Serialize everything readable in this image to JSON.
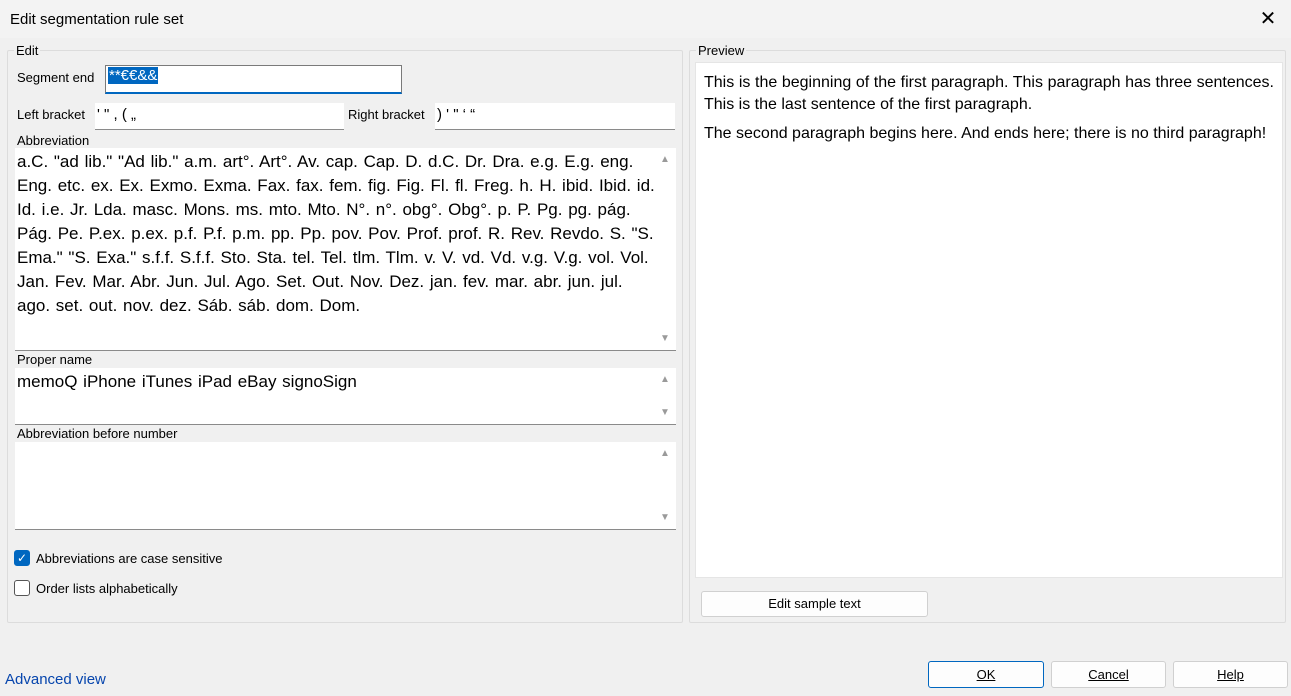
{
  "window": {
    "title": "Edit segmentation rule set",
    "close_icon": "close-icon"
  },
  "edit_group": {
    "label": "Edit",
    "segment_end_label": "Segment end",
    "segment_end_value": "**€€&&",
    "left_bracket_label": "Left bracket",
    "left_bracket_value": "' \" , ( „",
    "right_bracket_label": "Right bracket",
    "right_bracket_value": ") ' \" ‘ “",
    "abbreviation_label": "Abbreviation",
    "abbreviation_value": "a.C. \"ad lib.\" \"Ad lib.\" a.m. art°. Art°. Av. cap. Cap. D. d.C. Dr. Dra. e.g. E.g. eng. Eng. etc. ex. Ex. Exmo. Exma. Fax. fax. fem. fig. Fig. Fl. fl. Freg. h. H. ibid. Ibid. id. Id. i.e. Jr. Lda. masc. Mons. ms. mto. Mto. N°. n°. obg°. Obg°. p. P. Pg. pg. pág. Pág. Pe. P.ex. p.ex. p.f. P.f. p.m. pp. Pp. pov. Pov. Prof. prof. R. Rev. Revdo. S. \"S. Ema.\" \"S. Exa.\" s.f.f. S.f.f. Sto. Sta. tel. Tel. tlm. Tlm. v. V. vd. Vd. v.g. V.g. vol. Vol. Jan. Fev. Mar. Abr. Jun. Jul. Ago. Set. Out. Nov. Dez. jan. fev. mar. abr. jun. jul. ago. set. out. nov. dez. Sáb. sáb. dom. Dom.",
    "proper_name_label": "Proper name",
    "proper_name_value": "memoQ iPhone iTunes iPad eBay signoSign",
    "abbr_before_number_label": "Abbreviation before number",
    "abbr_before_number_value": "",
    "case_sensitive_label": "Abbreviations are case sensitive",
    "case_sensitive_checked": true,
    "order_alpha_label": "Order lists alphabetically",
    "order_alpha_checked": false
  },
  "preview_group": {
    "label": "Preview",
    "paragraph_1": "This is the beginning of the first paragraph. This paragraph has three sentences. This is the last sentence of the first paragraph.",
    "paragraph_2": "The second paragraph begins here. And ends here; there is no third paragraph!",
    "edit_sample_button": "Edit sample text"
  },
  "footer": {
    "advanced_view_link": "Advanced view",
    "ok_button": "OK",
    "cancel_button": "Cancel",
    "help_button": "Help"
  }
}
